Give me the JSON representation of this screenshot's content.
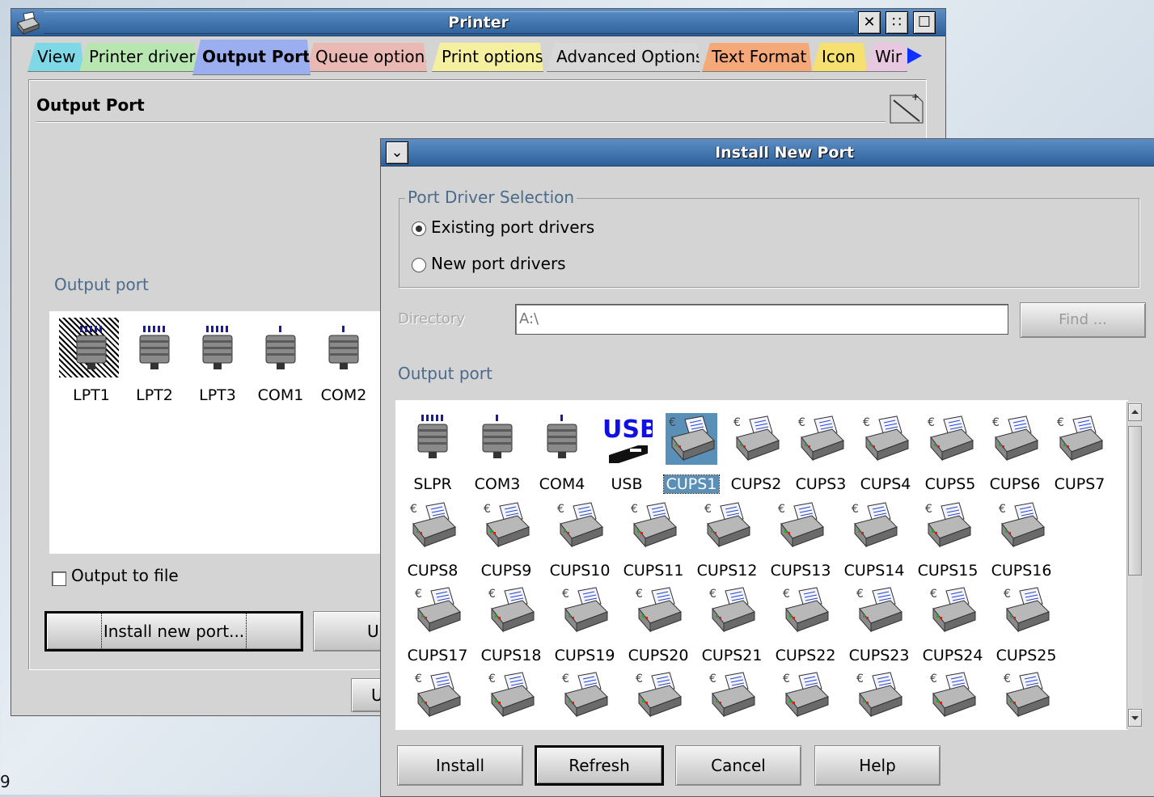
{
  "desktop": {
    "corner_text": "9"
  },
  "printer_window": {
    "title": "Printer",
    "tabs": [
      {
        "label": "View",
        "color": "#7fd8e6"
      },
      {
        "label": "Printer driver",
        "color": "#b8e6b0"
      },
      {
        "label": "Output Port",
        "color": "#9aaef0"
      },
      {
        "label": "Queue options",
        "color": "#eab9b4"
      },
      {
        "label": "Print options",
        "color": "#f5f0a0"
      },
      {
        "label": "Advanced Options",
        "color": "#d8d8d8"
      },
      {
        "label": "Text Format",
        "color": "#f5a878"
      },
      {
        "label": "Icon",
        "color": "#f5e070"
      },
      {
        "label": "Wir",
        "color": "#e8c8e0"
      }
    ],
    "panel_title": "Output Port",
    "output_port_label": "Output port",
    "ports": [
      {
        "label": "LPT1",
        "icon": "parallel-port-icon"
      },
      {
        "label": "LPT2",
        "icon": "parallel-port-icon"
      },
      {
        "label": "LPT3",
        "icon": "parallel-port-icon"
      },
      {
        "label": "COM1",
        "icon": "serial-port-icon"
      },
      {
        "label": "COM2",
        "icon": "serial-port-icon"
      }
    ],
    "output_to_file_label": "Output to file",
    "install_new_port_label": "Install new port...",
    "update_partial_label": "U",
    "bottom_partial_label": "U"
  },
  "install_dialog": {
    "title": "Install New Port",
    "group_title": "Port Driver Selection",
    "radio_existing": "Existing port drivers",
    "radio_new": "New port drivers",
    "directory_label": "Directory",
    "directory_value": "A:\\",
    "find_label": "Find ...",
    "output_port_label": "Output port",
    "ports_row1": [
      "SLPR",
      "COM3",
      "COM4",
      "USB",
      "CUPS1",
      "CUPS2",
      "CUPS3",
      "CUPS4",
      "CUPS5",
      "CUPS6",
      "CUPS7"
    ],
    "ports_row2": [
      "CUPS8",
      "CUPS9",
      "CUPS10",
      "CUPS11",
      "CUPS12",
      "CUPS13",
      "CUPS14",
      "CUPS15",
      "CUPS16"
    ],
    "ports_row3": [
      "CUPS17",
      "CUPS18",
      "CUPS19",
      "CUPS20",
      "CUPS21",
      "CUPS22",
      "CUPS23",
      "CUPS24",
      "CUPS25"
    ],
    "selected_port": "CUPS1",
    "usb_icon_text": "USB",
    "buttons": {
      "install": "Install",
      "refresh": "Refresh",
      "cancel": "Cancel",
      "help": "Help"
    }
  }
}
